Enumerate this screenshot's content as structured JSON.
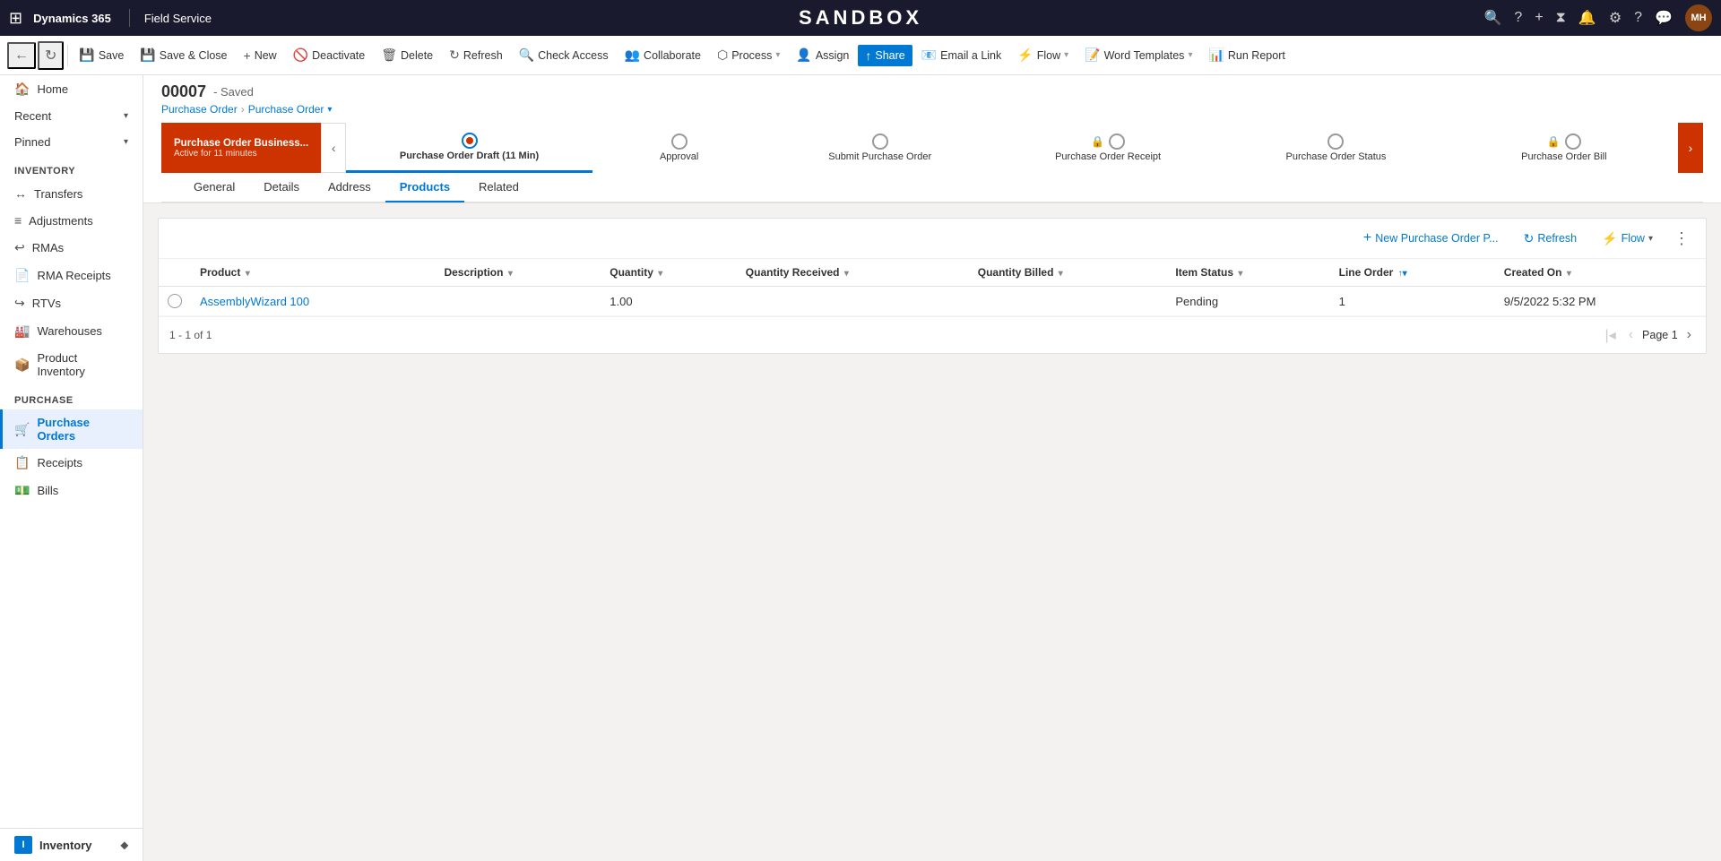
{
  "topNav": {
    "waffle": "⊞",
    "brand": "Dynamics 365",
    "divider": "|",
    "module": "Field Service",
    "sandbox": "SANDBOX",
    "avatarInitials": "MH"
  },
  "toolbar": {
    "back": "←",
    "forward": "⟳",
    "save": "Save",
    "saveClose": "Save & Close",
    "new": "New",
    "deactivate": "Deactivate",
    "delete": "Delete",
    "refresh": "Refresh",
    "checkAccess": "Check Access",
    "collaborate": "Collaborate",
    "process": "Process",
    "assign": "Assign",
    "share": "Share",
    "emailLink": "Email a Link",
    "flow": "Flow",
    "wordTemplates": "Word Templates",
    "runReport": "Run Report"
  },
  "record": {
    "id": "00007",
    "statusSuffix": "- Saved",
    "breadcrumb1": "Purchase Order",
    "breadcrumb2": "Purchase Order"
  },
  "processSteps": [
    {
      "label": "Purchase Order Draft",
      "sub": "(11 Min)",
      "active": true,
      "locked": false
    },
    {
      "label": "Approval",
      "sub": "",
      "active": false,
      "locked": false
    },
    {
      "label": "Submit Purchase Order",
      "sub": "",
      "active": false,
      "locked": false
    },
    {
      "label": "Purchase Order Receipt",
      "sub": "",
      "active": false,
      "locked": true
    },
    {
      "label": "Purchase Order Status",
      "sub": "",
      "active": false,
      "locked": false
    },
    {
      "label": "Purchase Order Bill",
      "sub": "",
      "active": false,
      "locked": true
    }
  ],
  "stageLabel": {
    "active": "Purchase Order Business...",
    "sub": "Active for 11 minutes"
  },
  "tabs": [
    {
      "label": "General",
      "active": false
    },
    {
      "label": "Details",
      "active": false
    },
    {
      "label": "Address",
      "active": false
    },
    {
      "label": "Products",
      "active": true
    },
    {
      "label": "Related",
      "active": false
    }
  ],
  "productsTable": {
    "toolbar": {
      "new": "New Purchase Order P...",
      "refresh": "Refresh",
      "flow": "Flow",
      "moreIcon": "⋮"
    },
    "columns": [
      {
        "key": "product",
        "label": "Product"
      },
      {
        "key": "description",
        "label": "Description"
      },
      {
        "key": "quantity",
        "label": "Quantity"
      },
      {
        "key": "quantityReceived",
        "label": "Quantity Received"
      },
      {
        "key": "quantityBilled",
        "label": "Quantity Billed"
      },
      {
        "key": "itemStatus",
        "label": "Item Status"
      },
      {
        "key": "lineOrder",
        "label": "Line Order"
      },
      {
        "key": "createdOn",
        "label": "Created On"
      }
    ],
    "rows": [
      {
        "product": "AssemblyWizard 100",
        "description": "",
        "quantity": "1.00",
        "quantityReceived": "",
        "quantityBilled": "",
        "itemStatus": "Pending",
        "lineOrder": "1",
        "createdOn": "9/5/2022 5:32 PM"
      }
    ],
    "footer": {
      "count": "1 - 1 of 1",
      "page": "Page 1"
    }
  },
  "sidebar": {
    "home": "Home",
    "recent": "Recent",
    "pinned": "Pinned",
    "inventory": {
      "header": "Inventory",
      "items": [
        {
          "label": "Transfers",
          "icon": "↔"
        },
        {
          "label": "Adjustments",
          "icon": "≡"
        },
        {
          "label": "RMAs",
          "icon": "↩"
        },
        {
          "label": "RMA Receipts",
          "icon": "📄"
        },
        {
          "label": "RTVs",
          "icon": "↪"
        },
        {
          "label": "Warehouses",
          "icon": "🏭"
        },
        {
          "label": "Product Inventory",
          "icon": "📦"
        }
      ]
    },
    "purchase": {
      "header": "Purchase",
      "items": [
        {
          "label": "Purchase Orders",
          "active": true,
          "icon": "🛒"
        },
        {
          "label": "Receipts",
          "icon": "📋"
        },
        {
          "label": "Bills",
          "icon": "💵"
        }
      ]
    },
    "bottom": {
      "label": "Inventory",
      "icon": "I"
    }
  }
}
